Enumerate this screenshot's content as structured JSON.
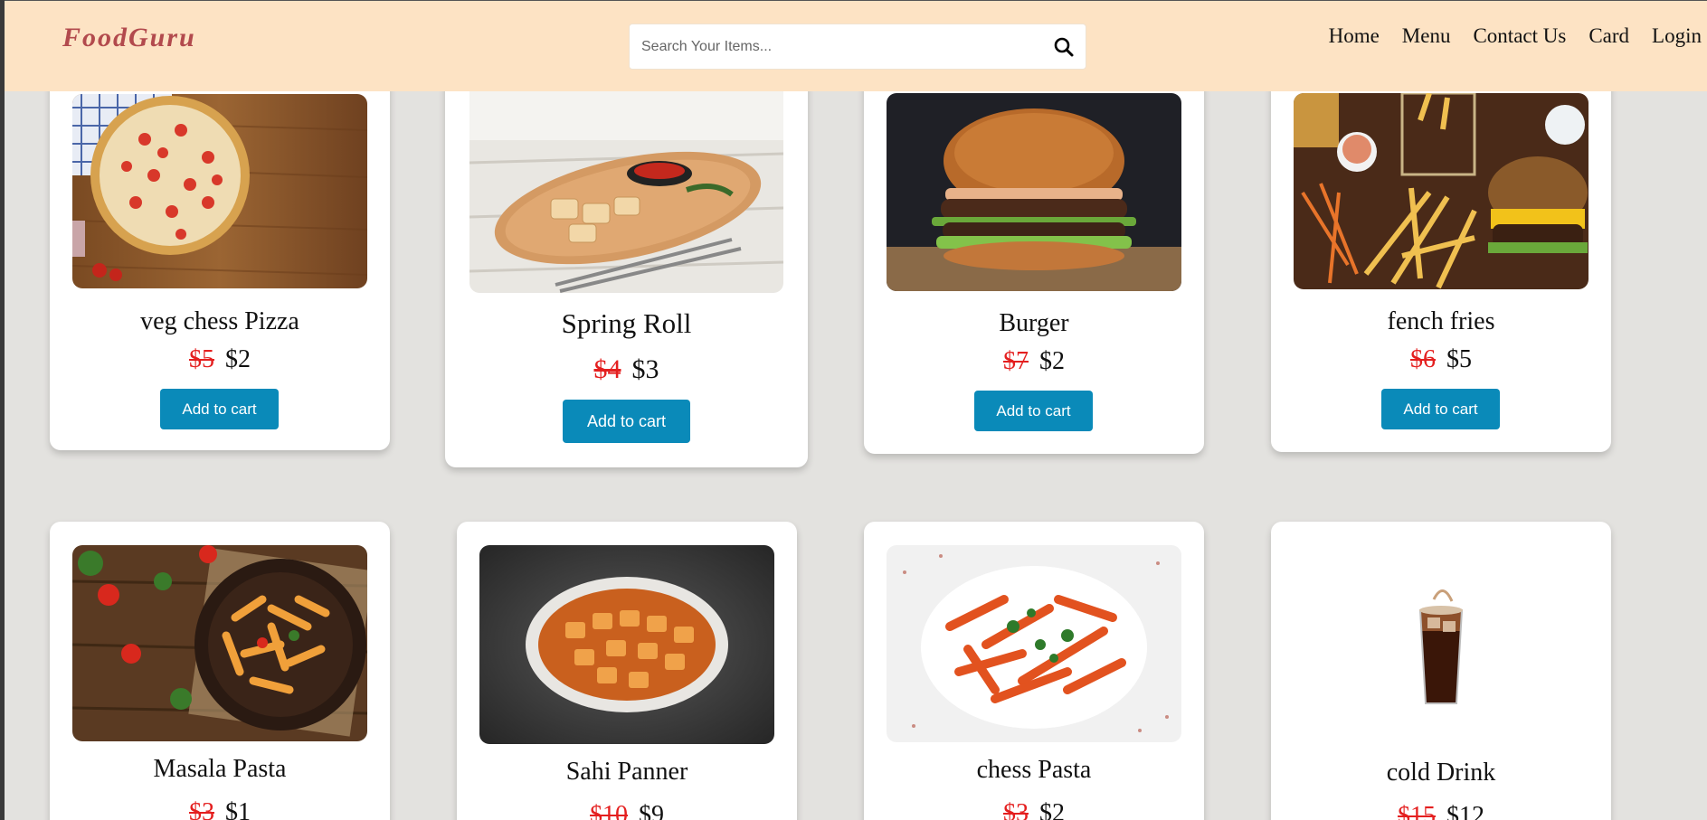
{
  "brand": "FoodGuru",
  "search": {
    "placeholder": "Search Your Items..."
  },
  "nav": [
    "Home",
    "Menu",
    "Contact Us",
    "Card",
    "Login"
  ],
  "products": [
    {
      "name": "veg chess Pizza",
      "old_price": "$5",
      "price": "$2",
      "button": "Add to cart"
    },
    {
      "name": "Spring Roll",
      "old_price": "$4",
      "price": "$3",
      "button": "Add to cart"
    },
    {
      "name": "Burger",
      "old_price": "$7",
      "price": "$2",
      "button": "Add to cart"
    },
    {
      "name": "fench fries",
      "old_price": "$6",
      "price": "$5",
      "button": "Add to cart"
    },
    {
      "name": "Masala Pasta",
      "old_price": "$3",
      "price": "$1"
    },
    {
      "name": "Sahi Panner",
      "old_price": "$10",
      "price": "$9"
    },
    {
      "name": "chess Pasta",
      "old_price": "$3",
      "price": "$2"
    },
    {
      "name": "cold Drink",
      "old_price": "$15",
      "price": "$12"
    }
  ],
  "icons": [
    "search-icon"
  ],
  "colors": {
    "navbar": "#fde3c4",
    "brand": "#b24a4d",
    "button": "#0a8ab9",
    "old_price": "#e41f1f",
    "background": "#e3e2df"
  }
}
